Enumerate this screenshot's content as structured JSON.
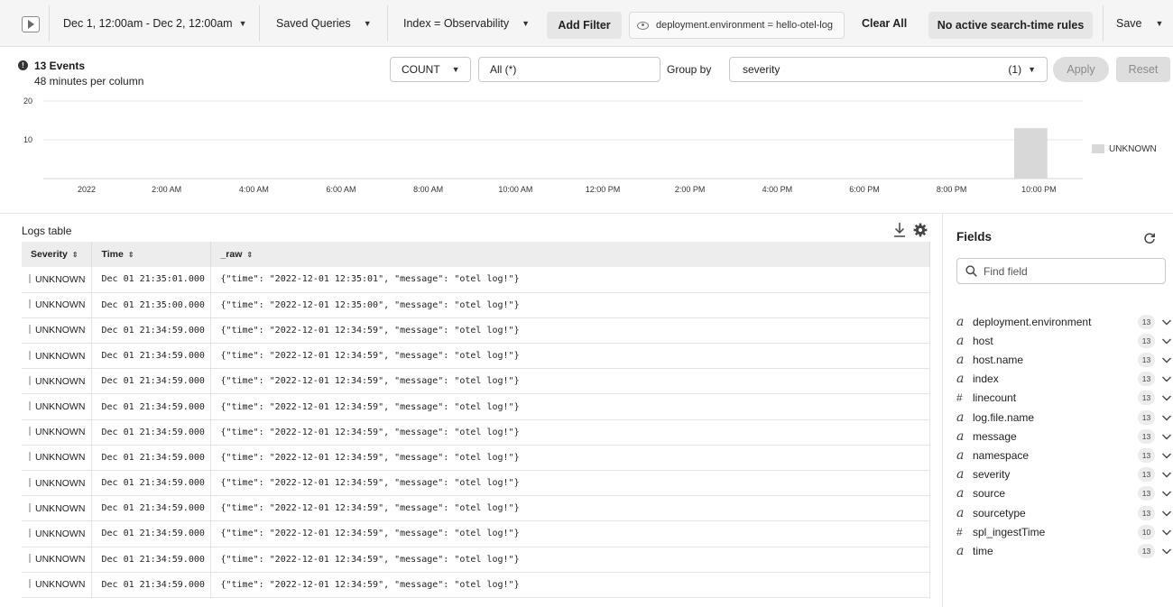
{
  "toolbar": {
    "time_range": "Dec 1, 12:00am - Dec 2, 12:00am",
    "saved_queries": "Saved Queries",
    "index_filter": "Index = Observability",
    "add_filter": "Add Filter",
    "filter_pill": "deployment.environment = hello-otel-log",
    "clear_all": "Clear All",
    "search_rules": "No active search-time rules",
    "save": "Save"
  },
  "summary": {
    "events": "13 Events",
    "interval": "48 minutes per column"
  },
  "controls": {
    "aggregate": "COUNT",
    "field": "All (*)",
    "group_by_label": "Group by",
    "group_by_value": "severity",
    "group_by_count": "(1)",
    "apply": "Apply",
    "reset": "Reset"
  },
  "chart_data": {
    "type": "bar",
    "title": "",
    "xlabel": "",
    "ylabel": "",
    "ylim": [
      0,
      20
    ],
    "yticks": [
      10,
      20
    ],
    "x_tick_labels": [
      "2022",
      "2:00 AM",
      "4:00 AM",
      "6:00 AM",
      "8:00 AM",
      "10:00 AM",
      "12:00 PM",
      "2:00 PM",
      "4:00 PM",
      "6:00 PM",
      "8:00 PM",
      "10:00 PM"
    ],
    "bin_minutes": 48,
    "series": [
      {
        "name": "UNKNOWN",
        "bins": [
          {
            "start": "21:36",
            "value": 13
          }
        ]
      }
    ],
    "legend_position": "right",
    "grid": true
  },
  "logs": {
    "title": "Logs table",
    "columns": [
      "Severity",
      "Time",
      "_raw"
    ],
    "rows": [
      {
        "severity": "UNKNOWN",
        "time": "Dec 01 21:35:01.000",
        "raw": "{\"time\": \"2022-12-01 12:35:01\", \"message\": \"otel log!\"}"
      },
      {
        "severity": "UNKNOWN",
        "time": "Dec 01 21:35:00.000",
        "raw": "{\"time\": \"2022-12-01 12:35:00\", \"message\": \"otel log!\"}"
      },
      {
        "severity": "UNKNOWN",
        "time": "Dec 01 21:34:59.000",
        "raw": "{\"time\": \"2022-12-01 12:34:59\", \"message\": \"otel log!\"}"
      },
      {
        "severity": "UNKNOWN",
        "time": "Dec 01 21:34:59.000",
        "raw": "{\"time\": \"2022-12-01 12:34:59\", \"message\": \"otel log!\"}"
      },
      {
        "severity": "UNKNOWN",
        "time": "Dec 01 21:34:59.000",
        "raw": "{\"time\": \"2022-12-01 12:34:59\", \"message\": \"otel log!\"}"
      },
      {
        "severity": "UNKNOWN",
        "time": "Dec 01 21:34:59.000",
        "raw": "{\"time\": \"2022-12-01 12:34:59\", \"message\": \"otel log!\"}"
      },
      {
        "severity": "UNKNOWN",
        "time": "Dec 01 21:34:59.000",
        "raw": "{\"time\": \"2022-12-01 12:34:59\", \"message\": \"otel log!\"}"
      },
      {
        "severity": "UNKNOWN",
        "time": "Dec 01 21:34:59.000",
        "raw": "{\"time\": \"2022-12-01 12:34:59\", \"message\": \"otel log!\"}"
      },
      {
        "severity": "UNKNOWN",
        "time": "Dec 01 21:34:59.000",
        "raw": "{\"time\": \"2022-12-01 12:34:59\", \"message\": \"otel log!\"}"
      },
      {
        "severity": "UNKNOWN",
        "time": "Dec 01 21:34:59.000",
        "raw": "{\"time\": \"2022-12-01 12:34:59\", \"message\": \"otel log!\"}"
      },
      {
        "severity": "UNKNOWN",
        "time": "Dec 01 21:34:59.000",
        "raw": "{\"time\": \"2022-12-01 12:34:59\", \"message\": \"otel log!\"}"
      },
      {
        "severity": "UNKNOWN",
        "time": "Dec 01 21:34:59.000",
        "raw": "{\"time\": \"2022-12-01 12:34:59\", \"message\": \"otel log!\"}"
      },
      {
        "severity": "UNKNOWN",
        "time": "Dec 01 21:34:59.000",
        "raw": "{\"time\": \"2022-12-01 12:34:59\", \"message\": \"otel log!\"}"
      }
    ]
  },
  "fields": {
    "title": "Fields",
    "search_placeholder": "Find field",
    "items": [
      {
        "type": "a",
        "name": "deployment.environment",
        "count": "13"
      },
      {
        "type": "a",
        "name": "host",
        "count": "13"
      },
      {
        "type": "a",
        "name": "host.name",
        "count": "13"
      },
      {
        "type": "a",
        "name": "index",
        "count": "13"
      },
      {
        "type": "#",
        "name": "linecount",
        "count": "13"
      },
      {
        "type": "a",
        "name": "log.file.name",
        "count": "13"
      },
      {
        "type": "a",
        "name": "message",
        "count": "13"
      },
      {
        "type": "a",
        "name": "namespace",
        "count": "13"
      },
      {
        "type": "a",
        "name": "severity",
        "count": "13"
      },
      {
        "type": "a",
        "name": "source",
        "count": "13"
      },
      {
        "type": "a",
        "name": "sourcetype",
        "count": "13"
      },
      {
        "type": "#",
        "name": "spl_ingestTime",
        "count": "10"
      },
      {
        "type": "a",
        "name": "time",
        "count": "13"
      }
    ]
  },
  "colors": {
    "bar": "#d8d8d8",
    "toolbar_bg": "#f5f5f5",
    "button_bg": "#e6e6e6"
  }
}
